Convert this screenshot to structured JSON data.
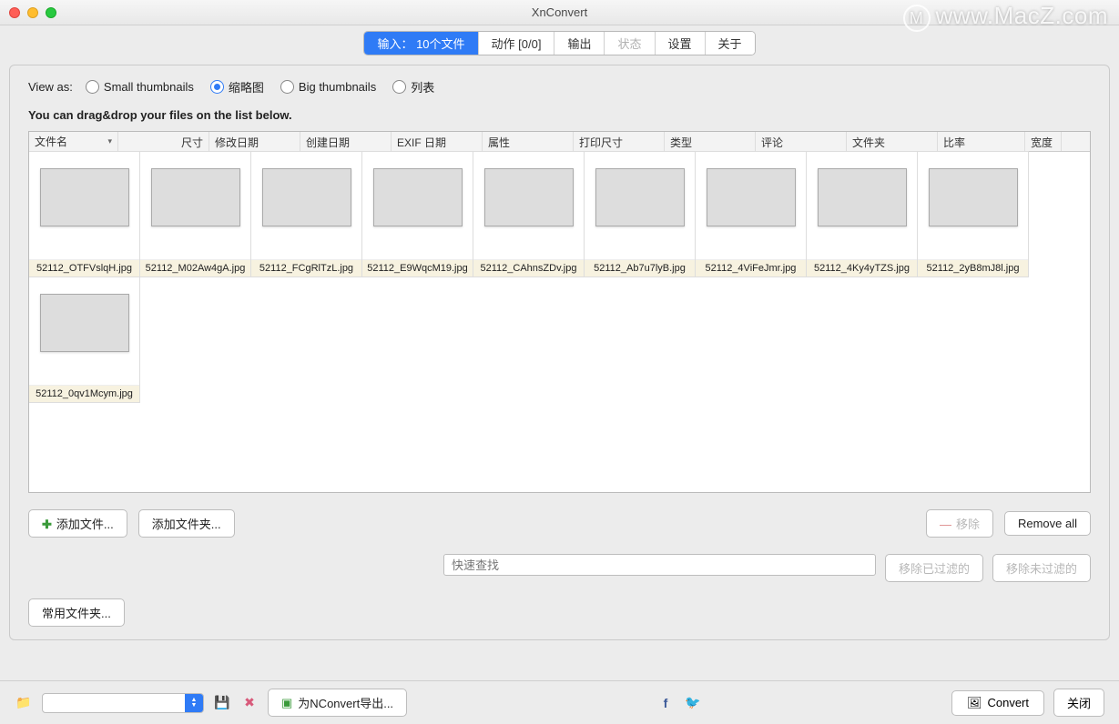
{
  "window": {
    "title": "XnConvert"
  },
  "watermark": "www.MacZ.com",
  "tabs": [
    {
      "label": "输入： 10个文件",
      "key": "input",
      "active": true
    },
    {
      "label": "动作 [0/0]",
      "key": "actions"
    },
    {
      "label": "输出",
      "key": "output"
    },
    {
      "label": "状态",
      "key": "status",
      "disabled": true
    },
    {
      "label": "设置",
      "key": "settings"
    },
    {
      "label": "关于",
      "key": "about"
    }
  ],
  "viewas": {
    "label": "View as:",
    "options": [
      {
        "label": "Small thumbnails",
        "selected": false
      },
      {
        "label": "缩略图",
        "selected": true
      },
      {
        "label": "Big thumbnails",
        "selected": false
      },
      {
        "label": "列表",
        "selected": false
      }
    ]
  },
  "hint": "You can drag&drop your files on the list below.",
  "columns": [
    {
      "label": "文件名",
      "w": 98,
      "dropdown": true
    },
    {
      "label": "尺寸",
      "w": 100,
      "align": "right"
    },
    {
      "label": "修改日期",
      "w": 100
    },
    {
      "label": "创建日期",
      "w": 100
    },
    {
      "label": "EXIF 日期",
      "w": 100
    },
    {
      "label": "属性",
      "w": 100
    },
    {
      "label": "打印尺寸",
      "w": 100
    },
    {
      "label": "类型",
      "w": 100
    },
    {
      "label": "评论",
      "w": 100
    },
    {
      "label": "文件夹",
      "w": 100
    },
    {
      "label": "比率",
      "w": 96
    },
    {
      "label": "宽度",
      "w": 40
    }
  ],
  "files": [
    {
      "name": "52112_OTFVslqH.jpg",
      "cls": "g1"
    },
    {
      "name": "52112_M02Aw4gA.jpg",
      "cls": "g2"
    },
    {
      "name": "52112_FCgRlTzL.jpg",
      "cls": "g3"
    },
    {
      "name": "52112_E9WqcM19.jpg",
      "cls": "g4"
    },
    {
      "name": "52112_CAhnsZDv.jpg",
      "cls": "g5"
    },
    {
      "name": "52112_Ab7u7lyB.jpg",
      "cls": "g6"
    },
    {
      "name": "52112_4ViFeJmr.jpg",
      "cls": "g7"
    },
    {
      "name": "52112_4Ky4yTZS.jpg",
      "cls": "g8"
    },
    {
      "name": "52112_2yB8mJ8l.jpg",
      "cls": "g9"
    },
    {
      "name": "52112_0qv1Mcym.jpg",
      "cls": "g10"
    }
  ],
  "buttons": {
    "add_files": "添加文件...",
    "add_folder": "添加文件夹...",
    "remove": "移除",
    "remove_all": "Remove all",
    "remove_filtered": "移除已过滤的",
    "remove_unfiltered": "移除未过滤的",
    "common_folders": "常用文件夹...",
    "nconvert_export": "为NConvert导出...",
    "convert": "Convert",
    "close": "关闭"
  },
  "search": {
    "placeholder": "快速查找"
  }
}
